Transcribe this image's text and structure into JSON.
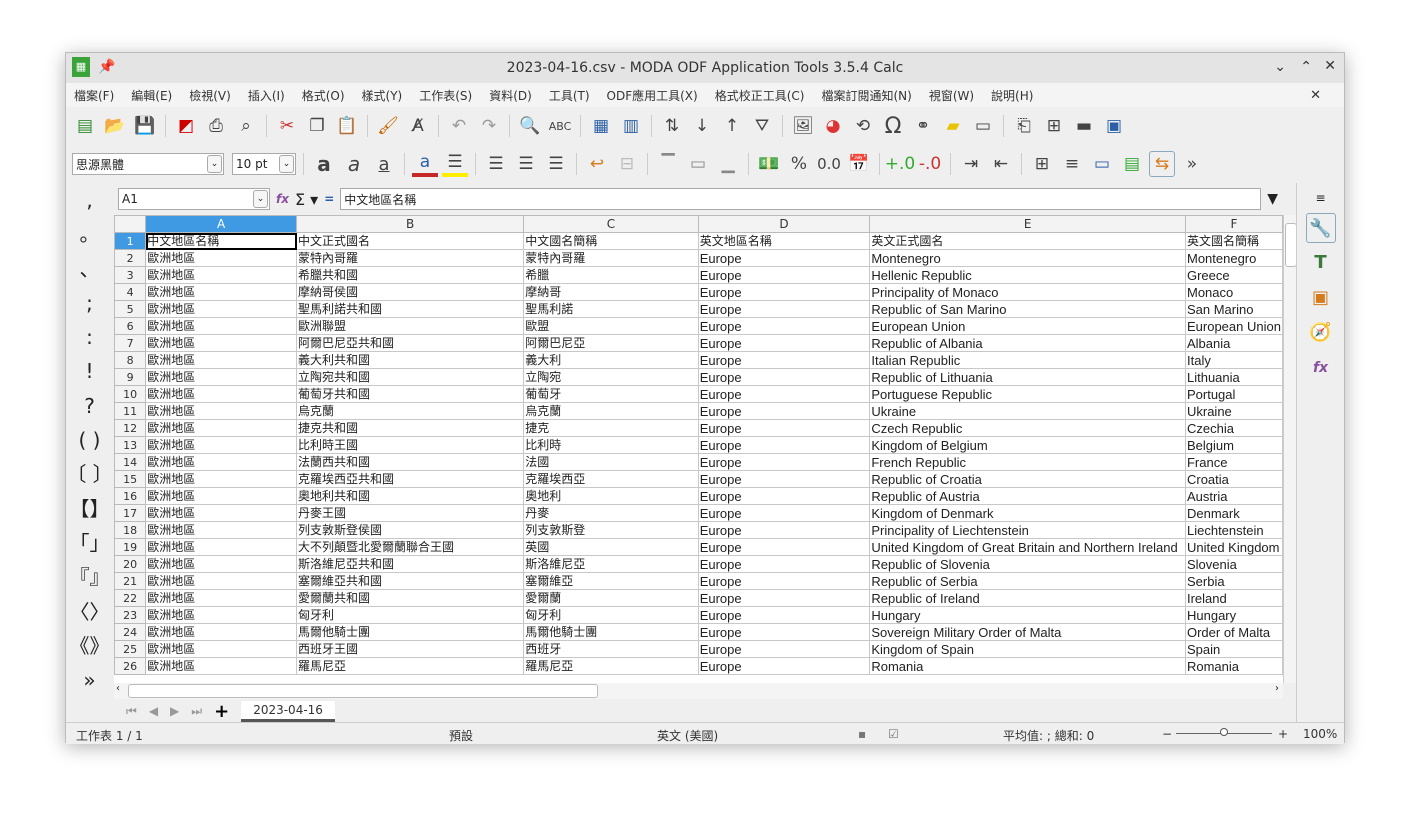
{
  "window": {
    "title": "2023-04-16.csv - MODA ODF Application Tools 3.5.4 Calc"
  },
  "menu": [
    "檔案(F)",
    "編輯(E)",
    "檢視(V)",
    "插入(I)",
    "格式(O)",
    "樣式(Y)",
    "工作表(S)",
    "資料(D)",
    "工具(T)",
    "ODF應用工具(X)",
    "格式校正工具(C)",
    "檔案訂閱通知(N)",
    "視窗(W)",
    "說明(H)"
  ],
  "format": {
    "font_name": "思源黑體",
    "font_size": "10 pt",
    "font_color": "#c62828",
    "highlight_color": "#ffee00"
  },
  "formula": {
    "cell_ref": "A1",
    "content": "中文地區名稱"
  },
  "punctuation": [
    ",",
    "。",
    "、",
    ";",
    ":",
    "!",
    "?",
    "( )",
    "〔 〕",
    "【】",
    "「」",
    "『』",
    "〈〉",
    "《》",
    "»"
  ],
  "columns": [
    "A",
    "B",
    "C",
    "D",
    "E",
    "F"
  ],
  "rows": [
    [
      "中文地區名稱",
      "中文正式國名",
      "中文國名簡稱",
      "英文地區名稱",
      "英文正式國名",
      "英文國名簡稱"
    ],
    [
      "歐洲地區",
      "蒙特內哥羅",
      "蒙特內哥羅",
      "Europe",
      "Montenegro",
      "Montenegro"
    ],
    [
      "歐洲地區",
      "希臘共和國",
      "希臘",
      "Europe",
      "Hellenic Republic",
      "Greece"
    ],
    [
      "歐洲地區",
      "摩納哥侯國",
      "摩納哥",
      "Europe",
      "Principality of Monaco",
      "Monaco"
    ],
    [
      "歐洲地區",
      "聖馬利諾共和國",
      "聖馬利諾",
      "Europe",
      "Republic of San Marino",
      "San Marino"
    ],
    [
      "歐洲地區",
      "歐洲聯盟",
      "歐盟",
      "Europe",
      "European Union",
      "European Union"
    ],
    [
      "歐洲地區",
      "阿爾巴尼亞共和國",
      "阿爾巴尼亞",
      "Europe",
      "Republic of Albania",
      "Albania"
    ],
    [
      "歐洲地區",
      "義大利共和國",
      "義大利",
      "Europe",
      "Italian Republic",
      "Italy"
    ],
    [
      "歐洲地區",
      "立陶宛共和國",
      "立陶宛",
      "Europe",
      "Republic of Lithuania",
      "Lithuania"
    ],
    [
      "歐洲地區",
      "葡萄牙共和國",
      "葡萄牙",
      "Europe",
      "Portuguese Republic",
      "Portugal"
    ],
    [
      "歐洲地區",
      "烏克蘭",
      "烏克蘭",
      "Europe",
      "Ukraine",
      "Ukraine"
    ],
    [
      "歐洲地區",
      "捷克共和國",
      "捷克",
      "Europe",
      "Czech Republic",
      "Czechia"
    ],
    [
      "歐洲地區",
      "比利時王國",
      "比利時",
      "Europe",
      "Kingdom of Belgium",
      "Belgium"
    ],
    [
      "歐洲地區",
      "法蘭西共和國",
      "法國",
      "Europe",
      "French Republic",
      "France"
    ],
    [
      "歐洲地區",
      "克羅埃西亞共和國",
      "克羅埃西亞",
      "Europe",
      "Republic of Croatia",
      "Croatia"
    ],
    [
      "歐洲地區",
      "奧地利共和國",
      "奧地利",
      "Europe",
      "Republic of Austria",
      "Austria"
    ],
    [
      "歐洲地區",
      "丹麥王國",
      "丹麥",
      "Europe",
      "Kingdom of Denmark",
      "Denmark"
    ],
    [
      "歐洲地區",
      "列支敦斯登侯國",
      "列支敦斯登",
      "Europe",
      "Principality of Liechtenstein",
      "Liechtenstein"
    ],
    [
      "歐洲地區",
      "大不列顛暨北愛爾蘭聯合王國",
      "英國",
      "Europe",
      "United Kingdom of Great Britain and Northern Ireland",
      "United Kingdom"
    ],
    [
      "歐洲地區",
      "斯洛維尼亞共和國",
      "斯洛維尼亞",
      "Europe",
      "Republic of Slovenia",
      "Slovenia"
    ],
    [
      "歐洲地區",
      "塞爾維亞共和國",
      "塞爾維亞",
      "Europe",
      "Republic of Serbia",
      "Serbia"
    ],
    [
      "歐洲地區",
      "愛爾蘭共和國",
      "愛爾蘭",
      "Europe",
      "Republic of Ireland",
      "Ireland"
    ],
    [
      "歐洲地區",
      "匈牙利",
      "匈牙利",
      "Europe",
      "Hungary",
      "Hungary"
    ],
    [
      "歐洲地區",
      "馬爾他騎士團",
      "馬爾他騎士團",
      "Europe",
      "Sovereign Military Order of Malta",
      "Order of Malta"
    ],
    [
      "歐洲地區",
      "西班牙王國",
      "西班牙",
      "Europe",
      "Kingdom of Spain",
      "Spain"
    ],
    [
      "歐洲地區",
      "羅馬尼亞",
      "羅馬尼亞",
      "Europe",
      "Romania",
      "Romania"
    ]
  ],
  "sheet_tab": "2023-04-16",
  "status": {
    "sheet": "工作表 1 / 1",
    "style": "預設",
    "language": "英文 (美國)",
    "summary": "平均值: ; 總和: 0",
    "zoom": "100%",
    "zoom_level": 100
  }
}
